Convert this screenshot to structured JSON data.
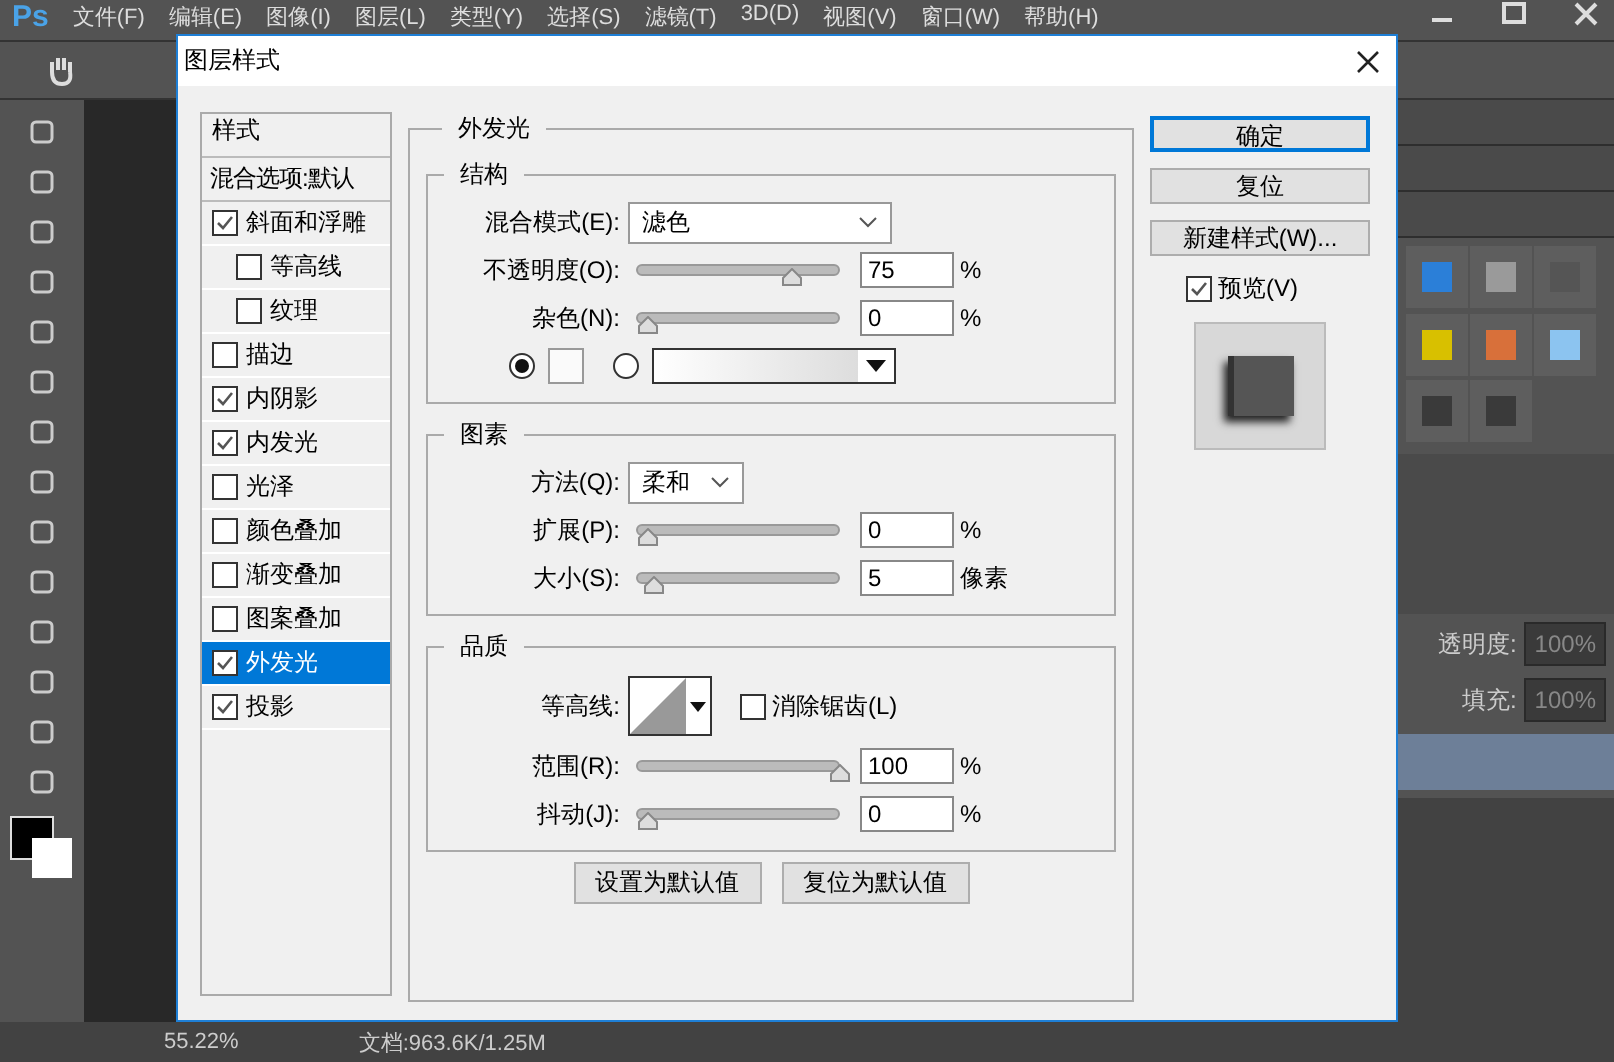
{
  "app": {
    "logo": "Ps",
    "menu": [
      "文件(F)",
      "编辑(E)",
      "图像(I)",
      "图层(L)",
      "类型(Y)",
      "选择(S)",
      "滤镜(T)",
      "3D(D)",
      "视图(V)",
      "窗口(W)",
      "帮助(H)"
    ],
    "layers_panel": {
      "opacity_label": "透明度:",
      "opacity_value": "100%",
      "fill_label": "填充:",
      "fill_value": "100%"
    },
    "status_bar": {
      "zoom": "55.22%",
      "document": "文档:963.6K/1.25M"
    }
  },
  "dialog": {
    "title": "图层样式",
    "styles_header": "样式",
    "blend_item": "混合选项:默认",
    "effects": [
      {
        "label": "斜面和浮雕",
        "checked": true,
        "selected": false,
        "children": [
          {
            "label": "等高线",
            "checked": false,
            "selected": false
          },
          {
            "label": "纹理",
            "checked": false,
            "selected": false
          }
        ]
      },
      {
        "label": "描边",
        "checked": false,
        "selected": false
      },
      {
        "label": "内阴影",
        "checked": true,
        "selected": false
      },
      {
        "label": "内发光",
        "checked": true,
        "selected": false
      },
      {
        "label": "光泽",
        "checked": false,
        "selected": false
      },
      {
        "label": "颜色叠加",
        "checked": false,
        "selected": false
      },
      {
        "label": "渐变叠加",
        "checked": false,
        "selected": false
      },
      {
        "label": "图案叠加",
        "checked": false,
        "selected": false
      },
      {
        "label": "外发光",
        "checked": true,
        "selected": true
      },
      {
        "label": "投影",
        "checked": true,
        "selected": false
      }
    ],
    "section_title": "外发光",
    "structure": {
      "title": "结构",
      "blend_label": "混合模式(E):",
      "blend_value": "滤色",
      "sliders": [
        {
          "label": "不透明度(O):",
          "level": 0.75,
          "value": "75",
          "unit": "%"
        },
        {
          "label": "杂色(N):",
          "level": 0,
          "value": "0",
          "unit": "%"
        }
      ],
      "fill_options": [
        {
          "kind": "color",
          "selected": true
        },
        {
          "kind": "gradient",
          "selected": false
        }
      ]
    },
    "elements": {
      "title": "图素",
      "method_label": "方法(Q):",
      "method_value": "柔和",
      "sliders": [
        {
          "label": "扩展(P):",
          "level": 0,
          "value": "0",
          "unit": "%"
        },
        {
          "label": "大小(S):",
          "level": 0.03,
          "value": "5",
          "unit": "像素"
        }
      ]
    },
    "quality": {
      "title": "品质",
      "contour_label": "等高线:",
      "anti_alias": {
        "label": "消除锯齿(L)",
        "checked": false
      },
      "sliders": [
        {
          "label": "范围(R):",
          "level": 1,
          "value": "100",
          "unit": "%"
        },
        {
          "label": "抖动(J):",
          "level": 0,
          "value": "0",
          "unit": "%"
        }
      ]
    },
    "bottom_buttons": [
      "设置为默认值",
      "复位为默认值"
    ],
    "side_buttons": [
      {
        "label": "确定",
        "default": true
      },
      {
        "label": "复位",
        "default": false
      },
      {
        "label": "新建样式(W)...",
        "default": false
      }
    ],
    "preview": {
      "label": "预览(V)",
      "checked": true
    }
  }
}
